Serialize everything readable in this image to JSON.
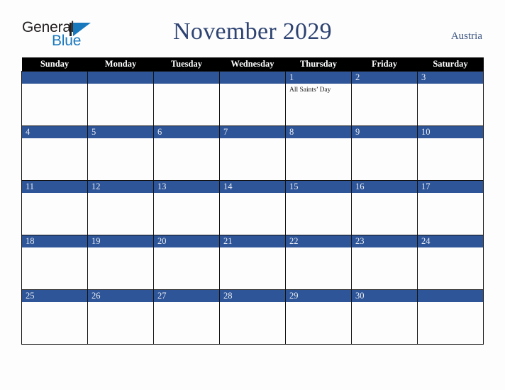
{
  "brand": {
    "top_text": "General",
    "bottom_text": "Blue",
    "mark_name": "blue-triangle-logo-mark",
    "color_dark": "#231f20",
    "color_blue": "#1878be"
  },
  "header": {
    "title": "November 2029",
    "country": "Austria",
    "title_color": "#2e4372",
    "country_color": "#3c5480"
  },
  "calendar": {
    "accent_color": "#2e5597",
    "header_bg": "#000000",
    "weekday_headers": [
      "Sunday",
      "Monday",
      "Tuesday",
      "Wednesday",
      "Thursday",
      "Friday",
      "Saturday"
    ],
    "weeks": [
      [
        {
          "day": "",
          "events": []
        },
        {
          "day": "",
          "events": []
        },
        {
          "day": "",
          "events": []
        },
        {
          "day": "",
          "events": []
        },
        {
          "day": "1",
          "events": [
            "All Saints’ Day"
          ]
        },
        {
          "day": "2",
          "events": []
        },
        {
          "day": "3",
          "events": []
        }
      ],
      [
        {
          "day": "4",
          "events": []
        },
        {
          "day": "5",
          "events": []
        },
        {
          "day": "6",
          "events": []
        },
        {
          "day": "7",
          "events": []
        },
        {
          "day": "8",
          "events": []
        },
        {
          "day": "9",
          "events": []
        },
        {
          "day": "10",
          "events": []
        }
      ],
      [
        {
          "day": "11",
          "events": []
        },
        {
          "day": "12",
          "events": []
        },
        {
          "day": "13",
          "events": []
        },
        {
          "day": "14",
          "events": []
        },
        {
          "day": "15",
          "events": []
        },
        {
          "day": "16",
          "events": []
        },
        {
          "day": "17",
          "events": []
        }
      ],
      [
        {
          "day": "18",
          "events": []
        },
        {
          "day": "19",
          "events": []
        },
        {
          "day": "20",
          "events": []
        },
        {
          "day": "21",
          "events": []
        },
        {
          "day": "22",
          "events": []
        },
        {
          "day": "23",
          "events": []
        },
        {
          "day": "24",
          "events": []
        }
      ],
      [
        {
          "day": "25",
          "events": []
        },
        {
          "day": "26",
          "events": []
        },
        {
          "day": "27",
          "events": []
        },
        {
          "day": "28",
          "events": []
        },
        {
          "day": "29",
          "events": []
        },
        {
          "day": "30",
          "events": []
        },
        {
          "day": "",
          "events": []
        }
      ]
    ]
  }
}
